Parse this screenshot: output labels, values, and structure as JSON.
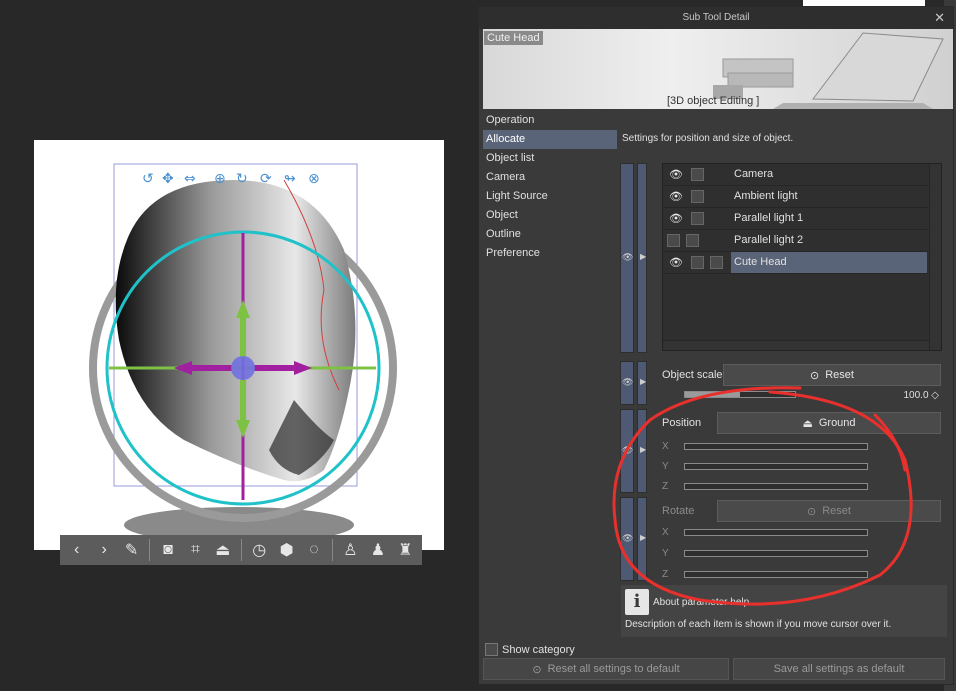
{
  "dialog": {
    "title": "Sub Tool Detail",
    "close_label": "✕",
    "preview_name": "Cute Head",
    "preview_caption": "[3D object Editing ]"
  },
  "categories": [
    {
      "label": "Operation",
      "active": false
    },
    {
      "label": "Allocate",
      "active": true
    },
    {
      "label": "Object list",
      "active": false
    },
    {
      "label": "Camera",
      "active": false
    },
    {
      "label": "Light Source",
      "active": false
    },
    {
      "label": "Object",
      "active": false
    },
    {
      "label": "Outline",
      "active": false
    },
    {
      "label": "Preference",
      "active": false
    }
  ],
  "show_category_label": "Show category",
  "settings": {
    "description": "Settings for position and size of object.",
    "layers": [
      {
        "name": "Camera",
        "visible": true
      },
      {
        "name": "Ambient light",
        "visible": true
      },
      {
        "name": "Parallel light 1",
        "visible": true
      },
      {
        "name": "Parallel light 2",
        "visible": false
      },
      {
        "name": "Cute Head",
        "visible": true,
        "selected": true
      }
    ],
    "object_scale_label": "Object scale",
    "reset_label": "Reset",
    "scale_value": "100.0",
    "scale_fraction": 0.5,
    "position_label": "Position",
    "ground_label": "Ground",
    "axes": [
      "X",
      "Y",
      "Z"
    ],
    "rotate_label": "Rotate",
    "rotate_reset_label": "Reset"
  },
  "help": {
    "title": "About parameter help",
    "text": "Description of each item is shown if you move cursor over it.",
    "icon": "info-icon"
  },
  "footer": {
    "reset_all": "Reset all settings to default",
    "save_all": "Save all settings as default"
  },
  "colors": {
    "accent_selected": "#5a6478",
    "gizmo_ring": "#1fc2c8",
    "gizmo_x_axis": "#7dc242",
    "gizmo_y_axis": "#a020a0",
    "annotation": "#e8302c"
  },
  "object_toolbar": {
    "icons": [
      "prev-icon",
      "next-icon",
      "wrench-icon",
      "camera-icon",
      "fit-icon",
      "ground-icon",
      "reset-icon",
      "object-icon",
      "rotate-icon",
      "light-icon",
      "light2-icon",
      "light3-icon"
    ]
  }
}
